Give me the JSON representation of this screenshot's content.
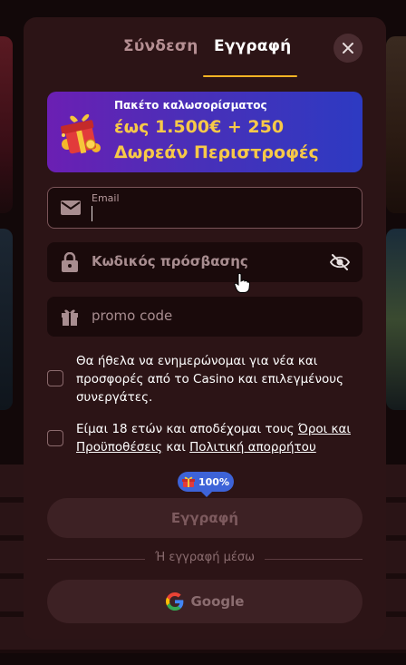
{
  "tabs": {
    "login": "Σύνδεση",
    "register": "Εγγραφή"
  },
  "banner": {
    "subtitle": "Πακέτο καλωσορίσματος",
    "line1": "έως 1.500€ + 250",
    "line2": "Δωρεάν Περιστροφές"
  },
  "form": {
    "email_label": "Email",
    "email_value": "",
    "password_placeholder": "Κωδικός πρόσβασης",
    "promo_placeholder": "promo code"
  },
  "consent": {
    "newsletter": "Θα ήθελα να ενημερώνομαι για νέα και προσφορές από το Casino και επιλεγμένους συνεργάτες.",
    "age_prefix": "Είμαι 18 ετών και αποδέχομαι τους ",
    "terms_link": "Όροι και Προϋποθέσεις",
    "and_word": " και ",
    "privacy_link": "Πολιτική απορρήτου"
  },
  "badge": {
    "percent": "100%"
  },
  "actions": {
    "register_label": "Εγγραφή",
    "divider_label": "Ή εγγραφή μέσω",
    "google_label": "Google"
  },
  "icons": {
    "close": "close-icon",
    "email": "envelope-icon",
    "password": "lock-icon",
    "promo": "gift-icon",
    "visibility": "eye-off-icon",
    "google": "google-icon"
  },
  "colors": {
    "modal_bg": "#2c1416",
    "field_bg": "#1a0a0b",
    "accent_underline": "#f5b324",
    "banner_text": "#f7c948",
    "badge_bg": "#3d63d8",
    "button_bg": "#3d2124"
  }
}
